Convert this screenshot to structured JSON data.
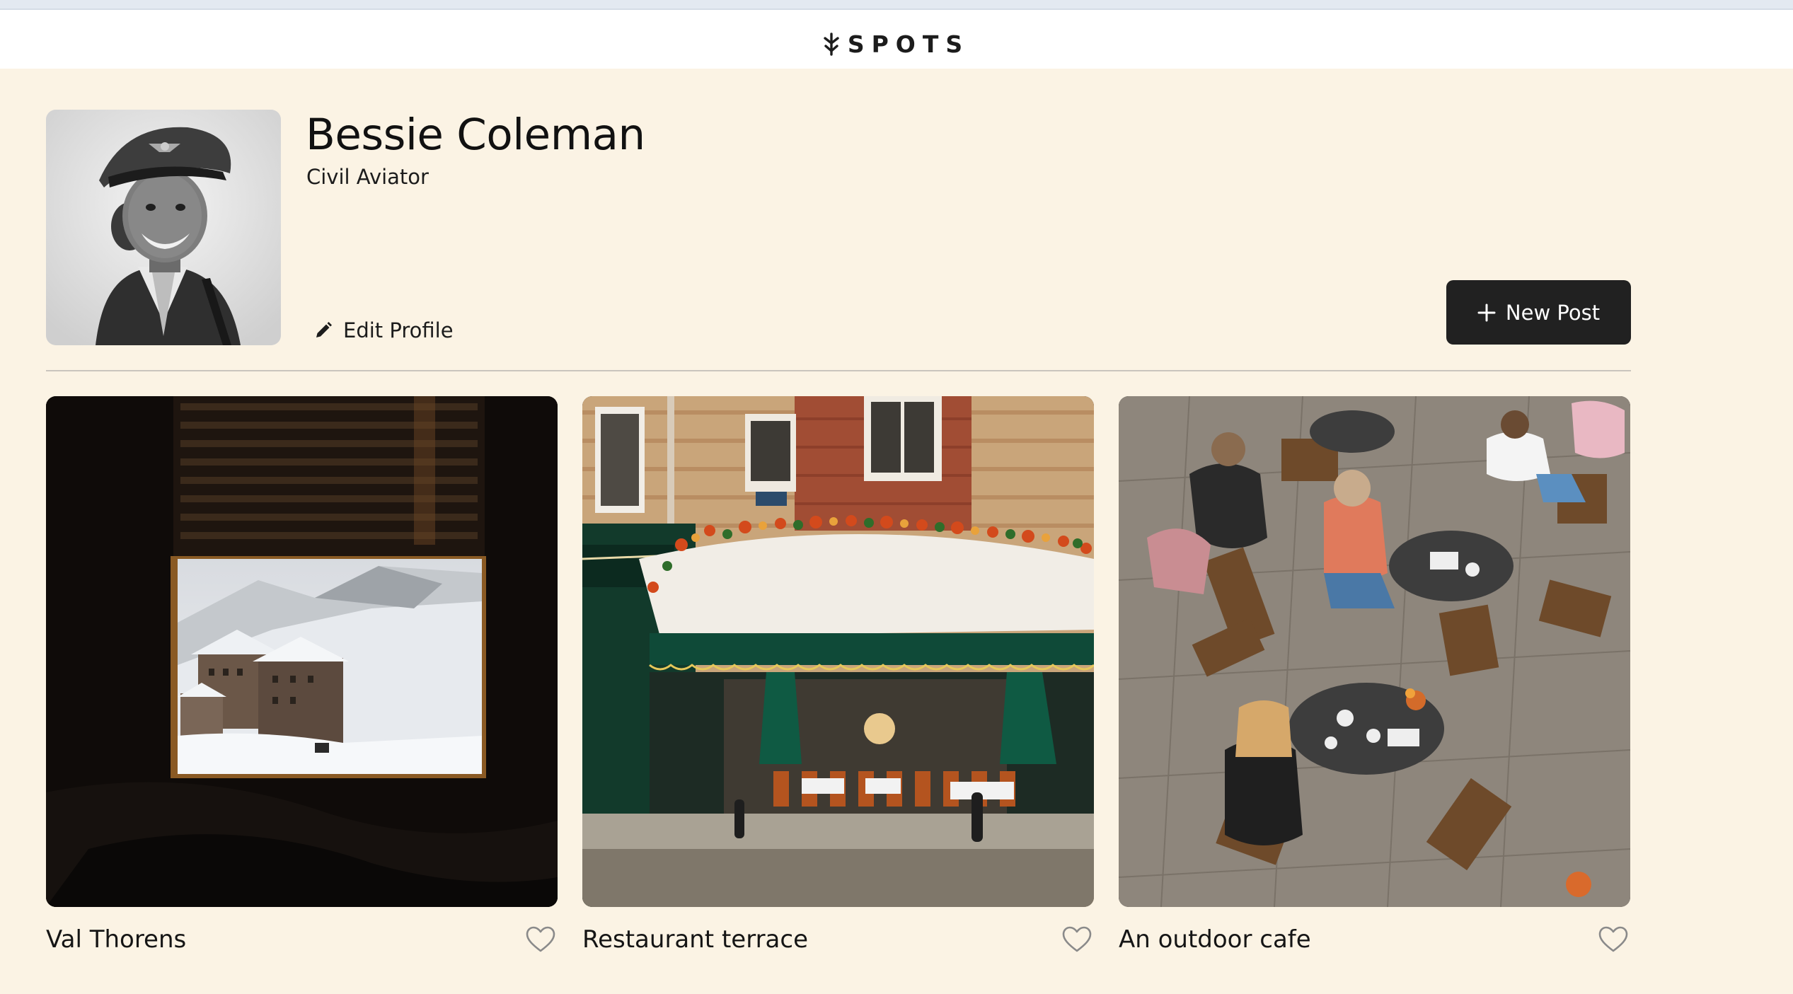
{
  "app": {
    "logo_text": "SPOTS",
    "logo_icon": "spots-logo-icon"
  },
  "profile": {
    "name": "Bessie Coleman",
    "title": "Civil Aviator",
    "avatar_icon": "avatar",
    "edit_label": "Edit Profile",
    "edit_icon": "pencil-icon"
  },
  "toolbar": {
    "new_post_label": "New Post",
    "new_post_icon": "plus-icon"
  },
  "cards": [
    {
      "title": "Val Thorens",
      "liked": false,
      "like_icon": "heart-outline-icon"
    },
    {
      "title": "Restaurant terrace",
      "liked": false,
      "like_icon": "heart-outline-icon"
    },
    {
      "title": "An outdoor cafe",
      "liked": false,
      "like_icon": "heart-outline-icon"
    }
  ],
  "colors": {
    "background": "#fbf3e4",
    "header": "#ffffff",
    "button": "#212121",
    "button_text": "#ffffff",
    "text": "#1c1c1c"
  }
}
